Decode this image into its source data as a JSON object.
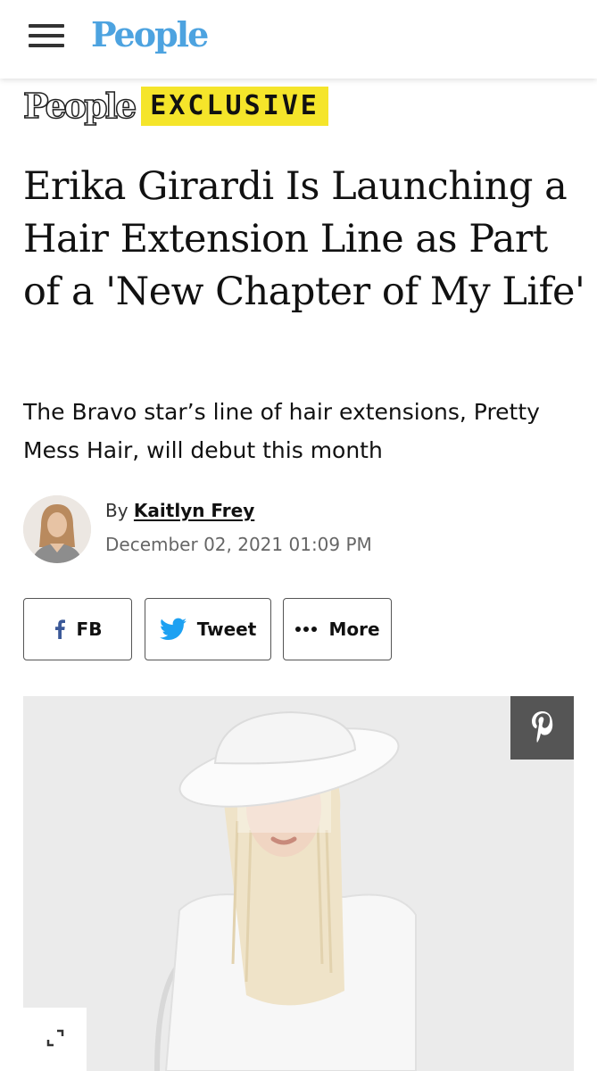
{
  "header": {
    "logo_text": "People",
    "logo_color": "#4da3e0"
  },
  "exclusive": {
    "logo_text": "People",
    "tag_text": "EXCLUSIVE",
    "tag_color": "#f5e52a"
  },
  "article": {
    "headline": "Erika Girardi Is Launching a Hair Extension Line as Part of a 'New Chapter of My Life'",
    "subhead": "The Bravo star’s line of hair extensions, Pretty Mess Hair, will debut this month",
    "byline_prefix": "By",
    "author": "Kaitlyn Frey",
    "date": "December 02, 2021 01:09 PM"
  },
  "share": {
    "fb_label": "FB",
    "tweet_label": "Tweet",
    "more_label": "More"
  },
  "icons": {
    "menu": "hamburger-menu-icon",
    "facebook": "facebook-icon",
    "twitter": "twitter-bird-icon",
    "more": "ellipsis-icon",
    "pinterest": "pinterest-icon",
    "expand": "expand-icon"
  }
}
